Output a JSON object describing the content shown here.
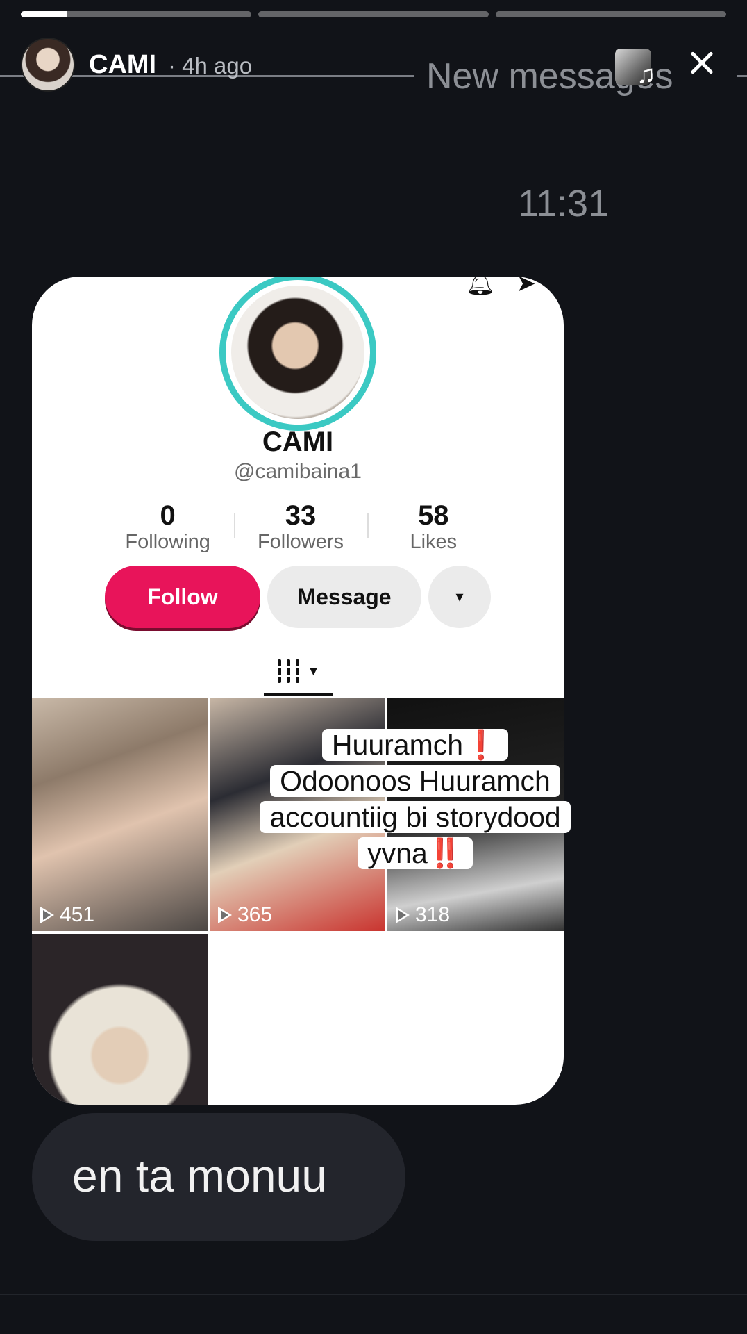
{
  "progress": {
    "segments": 3,
    "current_index": 0,
    "current_fill": 0.2
  },
  "header": {
    "username": "CAMI",
    "time_ago": "· 4h ago",
    "overlay_text": "New messages"
  },
  "icons": {
    "close": "close-icon",
    "music": "music-note-icon",
    "play": "play-icon"
  },
  "chat": {
    "timestamp": "11:31",
    "reply_text": "en ta monuu"
  },
  "profile": {
    "name": "CAMI",
    "handle": "@camibaina1",
    "stats": [
      {
        "value": "0",
        "label": "Following"
      },
      {
        "value": "33",
        "label": "Followers"
      },
      {
        "value": "58",
        "label": "Likes"
      }
    ],
    "follow_label": "Follow",
    "message_label": "Message",
    "more_label": "▾",
    "videos": [
      {
        "views": "451"
      },
      {
        "views": "365"
      },
      {
        "views": "318"
      },
      {
        "views": ""
      }
    ]
  },
  "caption": {
    "line1": "Huuramch",
    "line2": "Odoonoos Huuramch",
    "line3": "accountiig bi storydood",
    "line4": "yvna",
    "mark_single": "❗",
    "mark_double": "‼️"
  },
  "colors": {
    "accent_follow": "#e8145a",
    "ring": "#3bc9c3",
    "background": "#111318"
  }
}
